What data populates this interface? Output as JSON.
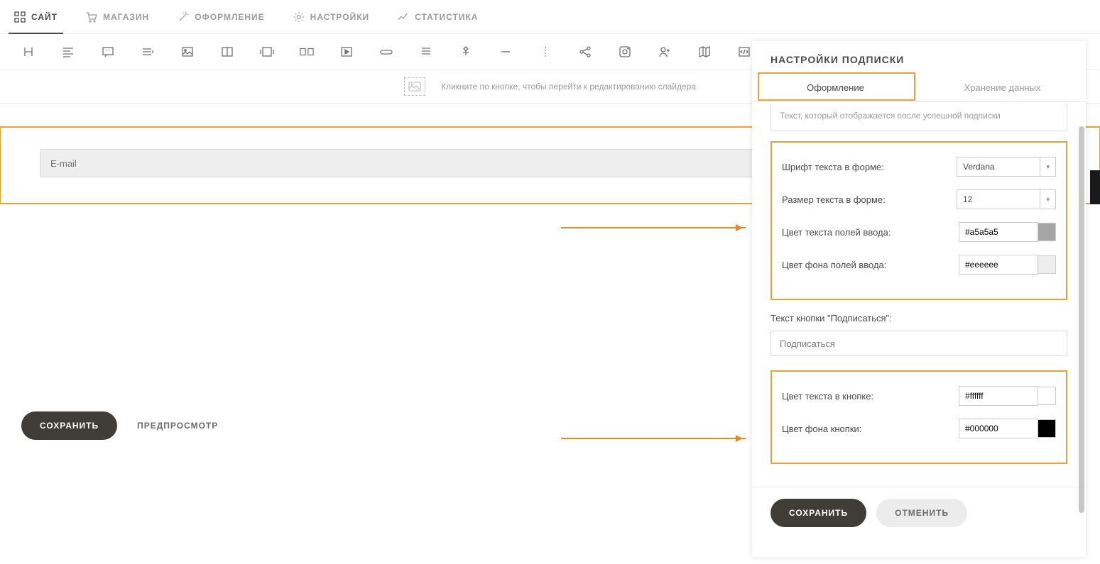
{
  "topnav": {
    "items": [
      {
        "label": "САЙТ"
      },
      {
        "label": "МАГАЗИН"
      },
      {
        "label": "ОФОРМЛЕНИЕ"
      },
      {
        "label": "НАСТРОЙКИ"
      },
      {
        "label": "СТАТИСТИКА"
      }
    ]
  },
  "slider_hint": "Кликните по кнопке, чтобы перейти к редактированию слайдера",
  "form": {
    "email_placeholder": "E-mail"
  },
  "bottom": {
    "save": "СОХРАНИТЬ",
    "preview": "ПРЕДПРОСМОТР"
  },
  "panel": {
    "title": "НАСТРОЙКИ ПОДПИСКИ",
    "tabs": {
      "design": "Оформление",
      "storage": "Хранение данных"
    },
    "success_text": "Текст, который отображается после успешной подписки",
    "font_label": "Шрифт текста в форме:",
    "font_value": "Verdana",
    "size_label": "Размер текста в форме:",
    "size_value": "12",
    "input_text_color_label": "Цвет текста полей ввода:",
    "input_text_color": "#a5a5a5",
    "input_bg_color_label": "Цвет фона полей ввода:",
    "input_bg_color": "#eeeeee",
    "button_text_label": "Текст кнопки \"Подписаться\":",
    "button_text_value": "Подписаться",
    "button_text_color_label": "Цвет текста в кнопке:",
    "button_text_color": "#ffffff",
    "button_bg_color_label": "Цвет фона кнопки:",
    "button_bg_color": "#000000",
    "save": "СОХРАНИТЬ",
    "cancel": "ОТМЕНИТЬ"
  },
  "swatch_colors": {
    "input_text": "#a5a5a5",
    "input_bg": "#eeeeee",
    "btn_text": "#ffffff",
    "btn_bg": "#000000"
  }
}
